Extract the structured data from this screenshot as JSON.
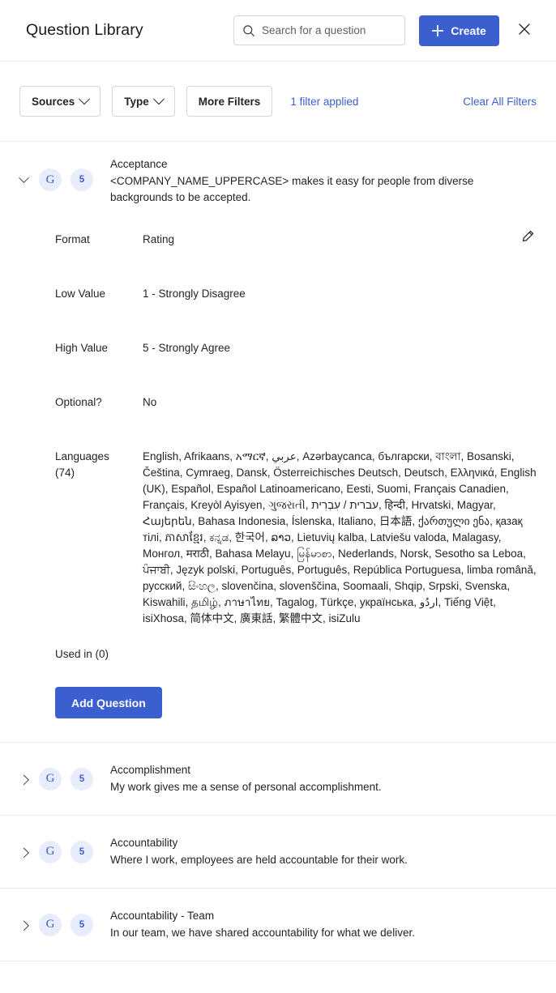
{
  "header": {
    "title": "Question Library",
    "search": {
      "placeholder": "Search for a question",
      "value": "",
      "icon": "search-icon"
    },
    "create_label": "Create",
    "close_icon": "close-icon",
    "accent_color": "#3b5fce"
  },
  "filters": {
    "sources_label": "Sources",
    "type_label": "Type",
    "more_filters_label": "More Filters",
    "applied_label": "1 filter applied",
    "clear_label": "Clear All Filters",
    "link_color": "#3b5fce"
  },
  "questions": [
    {
      "expanded": true,
      "source_icon": "G",
      "scale": "5",
      "title": "Acceptance",
      "text": "<COMPANY_NAME_UPPERCASE> makes it easy for people from diverse backgrounds to be accepted.",
      "details": {
        "format_label": "Format",
        "format_value": "Rating",
        "low_label": "Low Value",
        "low_value": "1 - Strongly Disagree",
        "high_label": "High Value",
        "high_value": "5 - Strongly Agree",
        "optional_label": "Optional?",
        "optional_value": "No",
        "languages_label": "Languages",
        "languages_count": "(74)",
        "languages_value": "English, Afrikaans, አማርኛ, عربي, Azərbaycanca, български, বাংলা, Bosanski, Čeština, Cymraeg, Dansk, Österreichisches Deutsch, Deutsch, Ελληνικά, English (UK), Español, Español Latinoamericano, Eesti, Suomi, Français Canadien, Français, Kreyòl Ayisyen, ગુજરાતી, עברית / עִבְרִית, हिन्दी, Hrvatski, Magyar, Հայերեն, Bahasa Indonesia, Íslenska, Italiano, 日本語, ქართული ენა, қазақ тілі, ភាសាខ្មែរ, ಕನ್ನಡ, 한국어, ລາວ, Lietuvių kalba, Latviešu valoda, Malagasy, Монгол, मराठी, Bahasa Melayu, မြန်မာစာ, Nederlands, Norsk, Sesotho sa Leboa, ਪੰਜਾਬੀ, Język polski, Português, Português, República Portuguesa, limba română, русский, සිංහල, slovenčina, slovenščina, Soomaali, Shqip, Srpski, Svenska, Kiswahili, தமிழ், ภาษาไทย, Tagalog, Türkçe, українська, اردُو, Tiếng Việt, isiXhosa, 简体中文, 廣東話, 繁體中文, isiZulu",
        "used_in_label": "Used in (0)",
        "add_question_label": "Add Question",
        "edit_icon": "pencil-icon"
      }
    },
    {
      "expanded": false,
      "source_icon": "G",
      "scale": "5",
      "title": "Accomplishment",
      "text": "My work gives me a sense of personal accomplishment."
    },
    {
      "expanded": false,
      "source_icon": "G",
      "scale": "5",
      "title": "Accountability",
      "text": "Where I work, employees are held accountable for their work."
    },
    {
      "expanded": false,
      "source_icon": "G",
      "scale": "5",
      "title": "Accountability - Team",
      "text": "In our team, we have shared accountability for what we deliver."
    }
  ]
}
